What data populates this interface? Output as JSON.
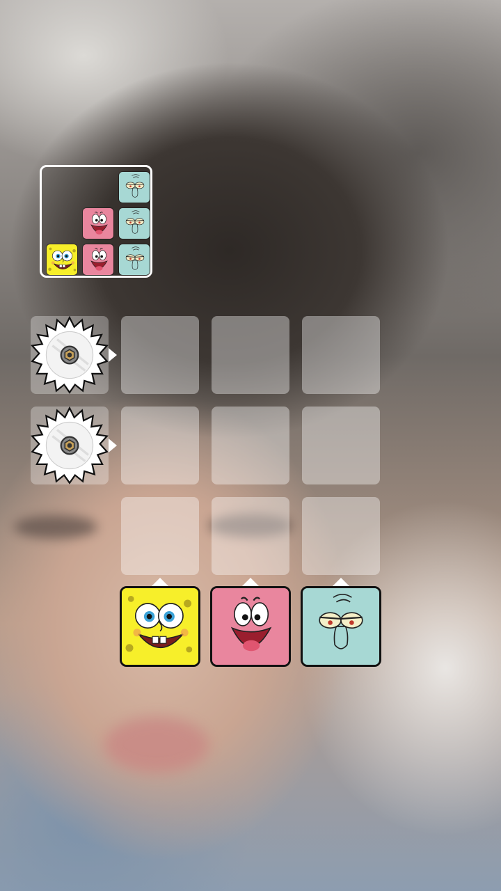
{
  "colors": {
    "spongebob": "#f7ef2a",
    "patrick": "#e9869e",
    "squidward": "#a7d8d4",
    "frame": "#ffffff",
    "grid_cell": "rgba(255,255,255,0.38)"
  },
  "target_pattern": {
    "rows": 3,
    "cols": 3,
    "cells": [
      [
        "empty",
        "empty",
        "squidward"
      ],
      [
        "empty",
        "patrick",
        "squidward"
      ],
      [
        "spongebob",
        "patrick",
        "squidward"
      ]
    ]
  },
  "board": {
    "rows": 3,
    "cols": 3,
    "saw_rows": [
      0,
      1
    ],
    "saw_icon": "circular-saw-icon"
  },
  "launchers": [
    {
      "character": "spongebob",
      "icon": "spongebob-face-icon"
    },
    {
      "character": "patrick",
      "icon": "patrick-face-icon"
    },
    {
      "character": "squidward",
      "icon": "squidward-face-icon"
    }
  ]
}
